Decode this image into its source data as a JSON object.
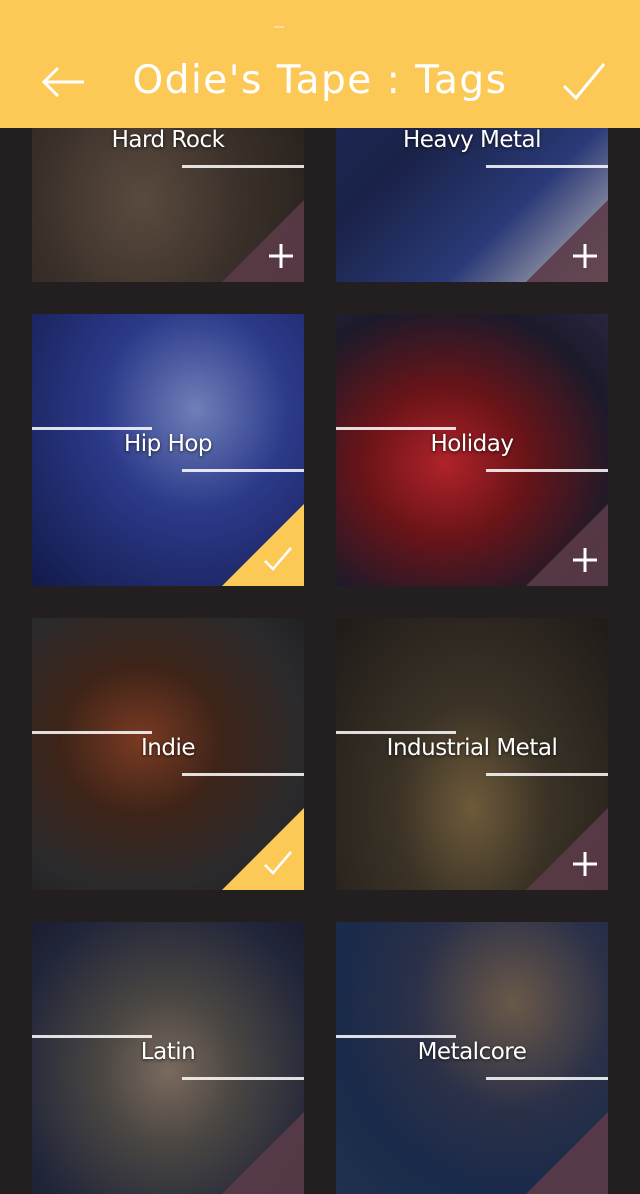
{
  "header": {
    "title": "Odie's Tape : Tags",
    "back_icon": "arrow-left-icon",
    "confirm_icon": "checkmark-icon",
    "background": "#fdc956"
  },
  "colors": {
    "page_background": "#231f20",
    "selected_corner": "#fdc956",
    "unselected_corner": "#5b3b48"
  },
  "tags": [
    {
      "label": "Hard Rock",
      "selected": false
    },
    {
      "label": "Heavy Metal",
      "selected": false
    },
    {
      "label": "Hip Hop",
      "selected": true
    },
    {
      "label": "Holiday",
      "selected": false
    },
    {
      "label": "Indie",
      "selected": true
    },
    {
      "label": "Industrial Metal",
      "selected": false
    },
    {
      "label": "Latin",
      "selected": false
    },
    {
      "label": "Metalcore",
      "selected": false
    }
  ]
}
